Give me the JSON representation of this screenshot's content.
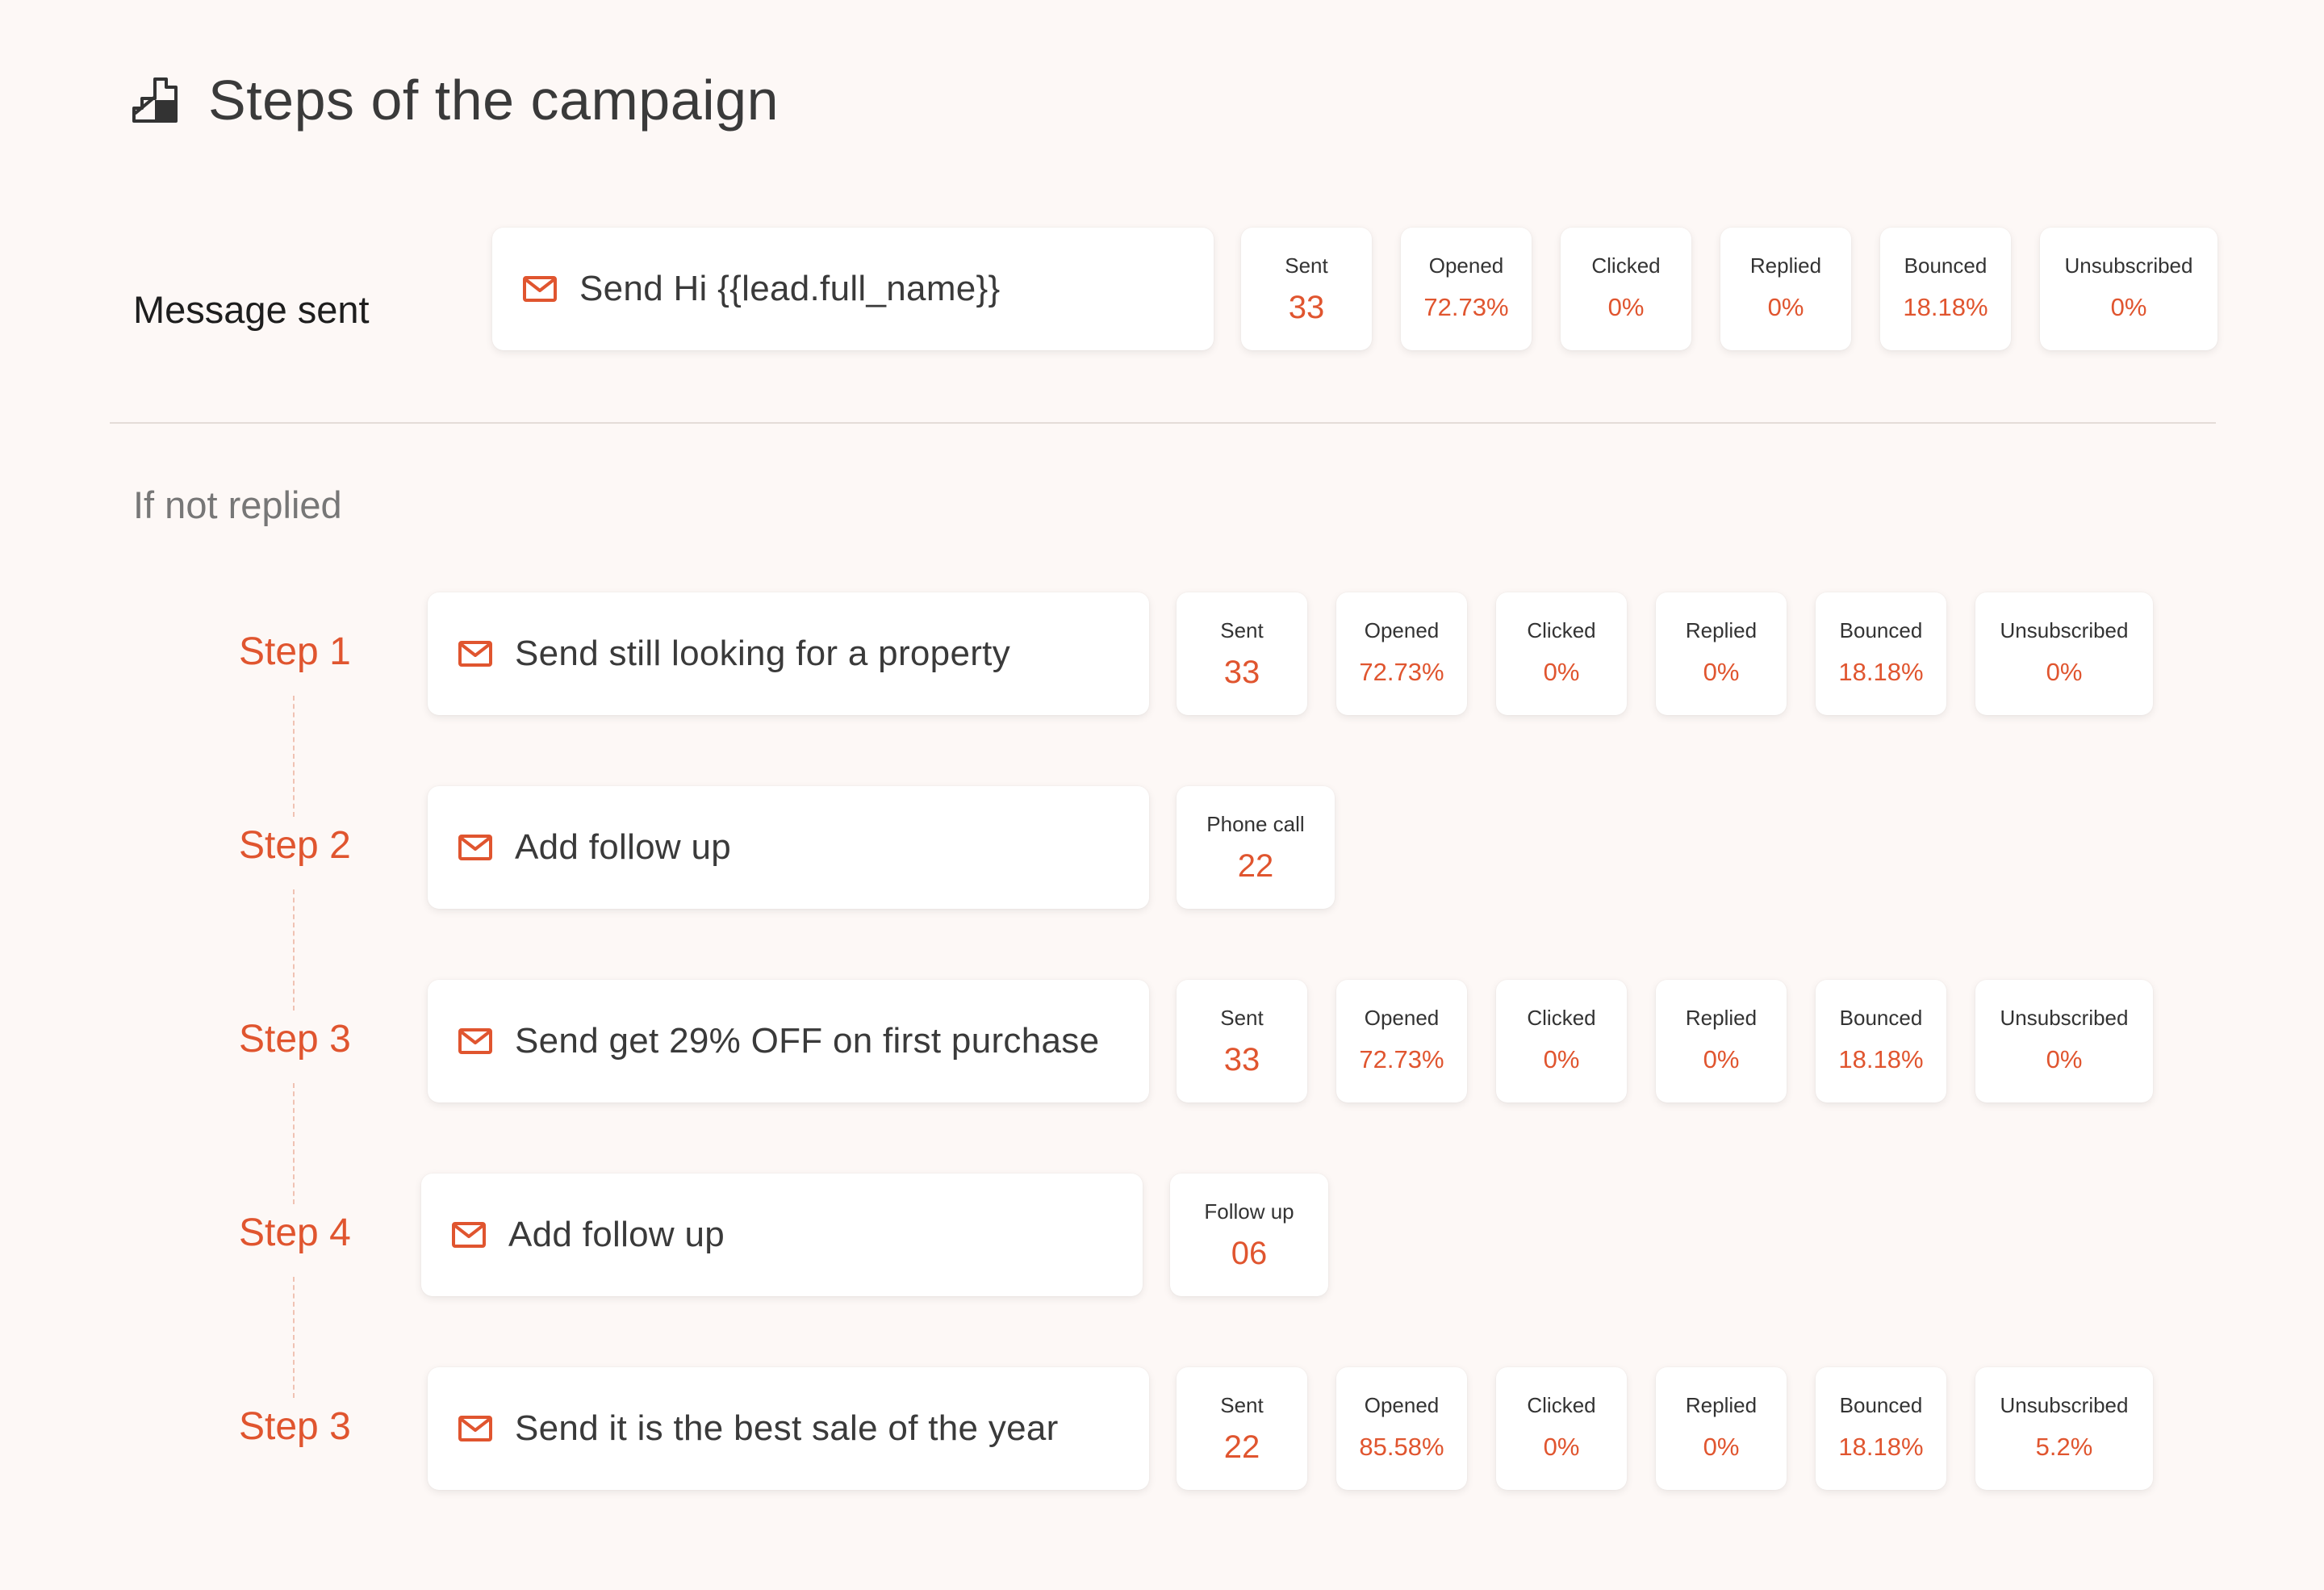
{
  "title": "Steps of the campaign",
  "message_sent": {
    "label": "Message sent",
    "message": "Send Hi {{lead.full_name}}",
    "stats": [
      {
        "label": "Sent",
        "value": "33"
      },
      {
        "label": "Opened",
        "value": "72.73%"
      },
      {
        "label": "Clicked",
        "value": "0%"
      },
      {
        "label": "Replied",
        "value": "0%"
      },
      {
        "label": "Bounced",
        "value": "18.18%"
      },
      {
        "label": "Unsubscribed",
        "value": "0%"
      }
    ]
  },
  "if_not_replied": {
    "label": "If not replied",
    "steps": [
      {
        "label": "Step 1",
        "message": "Send still looking for a property",
        "stats": [
          {
            "label": "Sent",
            "value": "33"
          },
          {
            "label": "Opened",
            "value": "72.73%"
          },
          {
            "label": "Clicked",
            "value": "0%"
          },
          {
            "label": "Replied",
            "value": "0%"
          },
          {
            "label": "Bounced",
            "value": "18.18%"
          },
          {
            "label": "Unsubscribed",
            "value": "0%"
          }
        ]
      },
      {
        "label": "Step 2",
        "message": "Add follow up",
        "stats": [
          {
            "label": "Phone call",
            "value": "22"
          }
        ]
      },
      {
        "label": "Step 3",
        "message": "Send get 29% OFF on first purchase",
        "stats": [
          {
            "label": "Sent",
            "value": "33"
          },
          {
            "label": "Opened",
            "value": "72.73%"
          },
          {
            "label": "Clicked",
            "value": "0%"
          },
          {
            "label": "Replied",
            "value": "0%"
          },
          {
            "label": "Bounced",
            "value": "18.18%"
          },
          {
            "label": "Unsubscribed",
            "value": "0%"
          }
        ]
      },
      {
        "label": "Step 4",
        "message": "Add follow up",
        "stats": [
          {
            "label": "Follow up",
            "value": "06"
          }
        ]
      },
      {
        "label": "Step 3",
        "message": "Send it is the best sale of the year",
        "stats": [
          {
            "label": "Sent",
            "value": "22"
          },
          {
            "label": "Opened",
            "value": "85.58%"
          },
          {
            "label": "Clicked",
            "value": "0%"
          },
          {
            "label": "Replied",
            "value": "0%"
          },
          {
            "label": "Bounced",
            "value": "18.18%"
          },
          {
            "label": "Unsubscribed",
            "value": "5.2%"
          }
        ]
      }
    ]
  },
  "colors": {
    "background": "#fdf8f6",
    "accent": "#e0552f",
    "card": "#ffffff",
    "dashed_connector": "#f0c2b3"
  },
  "icons": {
    "title": "stairs-icon",
    "message": "mail-icon"
  }
}
